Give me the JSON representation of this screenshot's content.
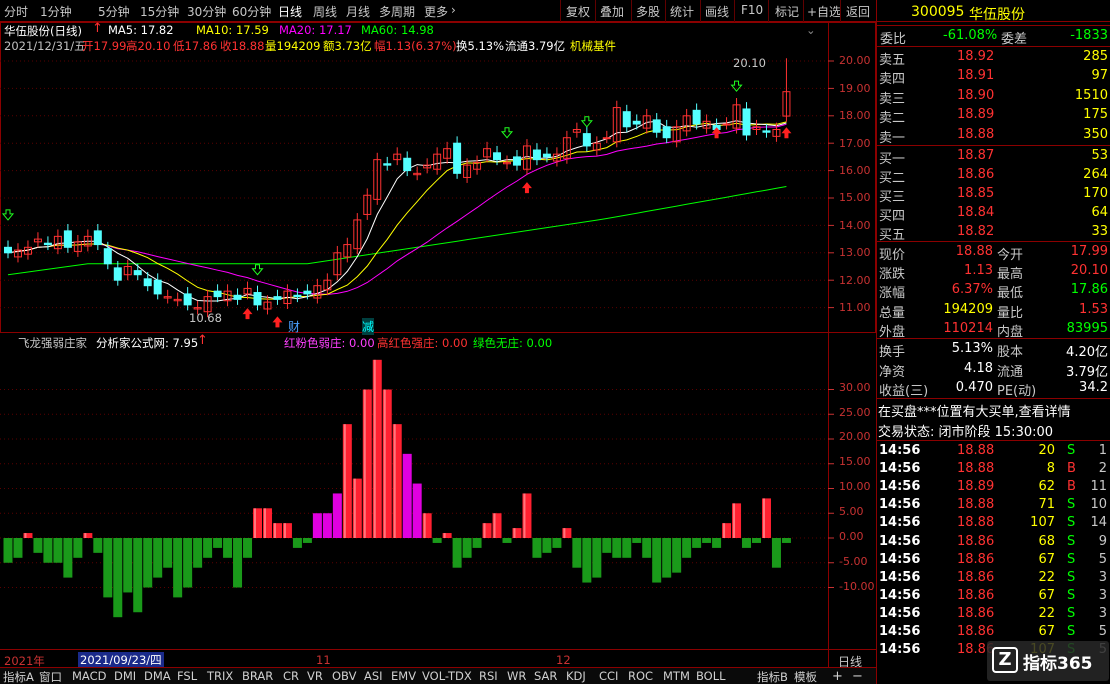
{
  "toolbar": {
    "periods": [
      "分时",
      "1分钟",
      "5分钟",
      "15分钟",
      "30分钟",
      "60分钟",
      "日线",
      "周线",
      "月线",
      "多周期",
      "更多"
    ],
    "selected_period": "日线",
    "more_arrow": "›",
    "actions": [
      "复权",
      "叠加",
      "多股",
      "统计",
      "画线",
      "F10",
      "标记",
      "+自选",
      "返回"
    ]
  },
  "chart_info": {
    "name_line": "华伍股份(日线)",
    "ma5": "MA5: 17.82",
    "ma10": "MA10: 17.59",
    "ma20": "MA20: 17.17",
    "ma60": "MA60: 14.98",
    "date": "2021/12/31/五",
    "open": "开17.99",
    "high": "高20.10",
    "low": "低17.86",
    "close": "收18.88",
    "volume": "量194209",
    "amount": "额3.73亿",
    "change": "幅1.13(6.37%)",
    "turnover": "换5.13%",
    "float_cap": "流通3.79亿",
    "sector": "机械基件",
    "hi_label": "20.10",
    "lo_label": "10.68",
    "mark_cai": "财",
    "mark_jian": "减",
    "colors": {
      "ma5": "#ffffff",
      "ma10": "#ffff00",
      "ma20": "#ff00ff",
      "ma60": "#00ff00",
      "up": "#ff3232",
      "down": "#54ffff"
    }
  },
  "price_axis": [
    "20.00",
    "19.00",
    "18.00",
    "17.00",
    "16.00",
    "15.00",
    "14.00",
    "13.00",
    "12.00",
    "11.00"
  ],
  "indicator": {
    "name": "飞龙强弱庄家",
    "source": "分析家公式网: 7.95",
    "label_a": "红粉色弱庄: 0.00",
    "label_b": "高红色强庄: 0.00",
    "label_c": "绿色无庄: 0.00",
    "axis": [
      "30.00",
      "25.00",
      "20.00",
      "15.00",
      "10.00",
      "5.00",
      "0.00",
      "-5.00",
      "-10.00"
    ]
  },
  "chart_data": {
    "type": "bar",
    "title": "飞龙强弱庄家",
    "ylim": [
      -12,
      37
    ],
    "values": [
      -5,
      -4,
      1,
      -3,
      -5,
      -5,
      -8,
      -4,
      1,
      -3,
      -12,
      -16,
      -11,
      -15,
      -10,
      -8,
      -6,
      -12,
      -10,
      -6,
      -4,
      -2,
      -4,
      -10,
      -4,
      6,
      6,
      3,
      3,
      -2,
      -1,
      5,
      5,
      9,
      23,
      12,
      30,
      36,
      30,
      23,
      17,
      11,
      5,
      -1,
      1,
      -6,
      -4,
      -2,
      3,
      5,
      -1,
      2,
      9,
      -4,
      -3,
      -2,
      2,
      -6,
      -9,
      -8,
      -3,
      -4,
      -4,
      -1,
      -4,
      -9,
      -8,
      -7,
      -4,
      -2,
      -1,
      -2,
      3,
      7,
      -2,
      -1,
      8,
      -6,
      -1
    ],
    "colors": {
      "strong": "#ff2030",
      "weak": "#e000e0",
      "none": "#1a9a1a"
    }
  },
  "x_axis": {
    "year": "2021年",
    "date_box": "2021/09/23/四",
    "m11": "11",
    "m12": "12",
    "period": "日线"
  },
  "bottom_tabs": [
    "指标A",
    "窗口",
    "MACD",
    "DMI",
    "DMA",
    "FSL",
    "TRIX",
    "BRAR",
    "CR",
    "VR",
    "OBV",
    "ASI",
    "EMV",
    "VOL-TDX",
    "RSI",
    "WR",
    "SAR",
    "KDJ",
    "CCI",
    "ROC",
    "MTM",
    "BOLL",
    "指标B",
    "模板"
  ],
  "right_panel": {
    "code": "300095",
    "name": "华伍股份",
    "weibi_label": "委比",
    "weibi": "-61.08%",
    "weicha_label": "委差",
    "weicha": "-1833",
    "sells": [
      {
        "label": "卖五",
        "price": "18.92",
        "vol": "285"
      },
      {
        "label": "卖四",
        "price": "18.91",
        "vol": "97"
      },
      {
        "label": "卖三",
        "price": "18.90",
        "vol": "1510"
      },
      {
        "label": "卖二",
        "price": "18.89",
        "vol": "175"
      },
      {
        "label": "卖一",
        "price": "18.88",
        "vol": "350"
      }
    ],
    "buys": [
      {
        "label": "买一",
        "price": "18.87",
        "vol": "53"
      },
      {
        "label": "买二",
        "price": "18.86",
        "vol": "264"
      },
      {
        "label": "买三",
        "price": "18.85",
        "vol": "170"
      },
      {
        "label": "买四",
        "price": "18.84",
        "vol": "64"
      },
      {
        "label": "买五",
        "price": "18.82",
        "vol": "33"
      }
    ],
    "quote": [
      {
        "l1": "现价",
        "v1": "18.88",
        "l2": "今开",
        "v2": "17.99"
      },
      {
        "l1": "涨跌",
        "v1": "1.13",
        "l2": "最高",
        "v2": "20.10"
      },
      {
        "l1": "涨幅",
        "v1": "6.37%",
        "l2": "最低",
        "v2": "17.86"
      },
      {
        "l1": "总量",
        "v1": "194209",
        "l2": "量比",
        "v2": "1.53"
      },
      {
        "l1": "外盘",
        "v1": "110214",
        "l2": "内盘",
        "v2": "83995"
      }
    ],
    "fin": [
      {
        "l1": "换手",
        "v1": "5.13%",
        "l2": "股本",
        "v2": "4.20亿"
      },
      {
        "l1": "净资",
        "v1": "4.18",
        "l2": "流通",
        "v2": "3.79亿"
      },
      {
        "l1": "收益(三)",
        "v1": "0.470",
        "l2": "PE(动)",
        "v2": "34.2"
      }
    ],
    "notice": "在买盘***位置有大买单,查看详情",
    "status": "交易状态: 闭市阶段 15:30:00",
    "ticks": [
      {
        "t": "14:56",
        "p": "18.88",
        "v": "20",
        "s": "S",
        "n": "1"
      },
      {
        "t": "14:56",
        "p": "18.88",
        "v": "8",
        "s": "B",
        "n": "2"
      },
      {
        "t": "14:56",
        "p": "18.89",
        "v": "62",
        "s": "B",
        "n": "11"
      },
      {
        "t": "14:56",
        "p": "18.88",
        "v": "71",
        "s": "S",
        "n": "10"
      },
      {
        "t": "14:56",
        "p": "18.88",
        "v": "107",
        "s": "S",
        "n": "14"
      },
      {
        "t": "14:56",
        "p": "18.86",
        "v": "68",
        "s": "S",
        "n": "9"
      },
      {
        "t": "14:56",
        "p": "18.86",
        "v": "67",
        "s": "S",
        "n": "5"
      },
      {
        "t": "14:56",
        "p": "18.86",
        "v": "22",
        "s": "S",
        "n": "3"
      },
      {
        "t": "14:56",
        "p": "18.86",
        "v": "67",
        "s": "S",
        "n": "3"
      },
      {
        "t": "14:56",
        "p": "18.86",
        "v": "22",
        "s": "S",
        "n": "3"
      },
      {
        "t": "14:56",
        "p": "18.86",
        "v": "67",
        "s": "S",
        "n": "5"
      },
      {
        "t": "14:56",
        "p": "18.86",
        "v": "107",
        "s": "S",
        "n": "5"
      }
    ],
    "watermark": "指标365"
  }
}
